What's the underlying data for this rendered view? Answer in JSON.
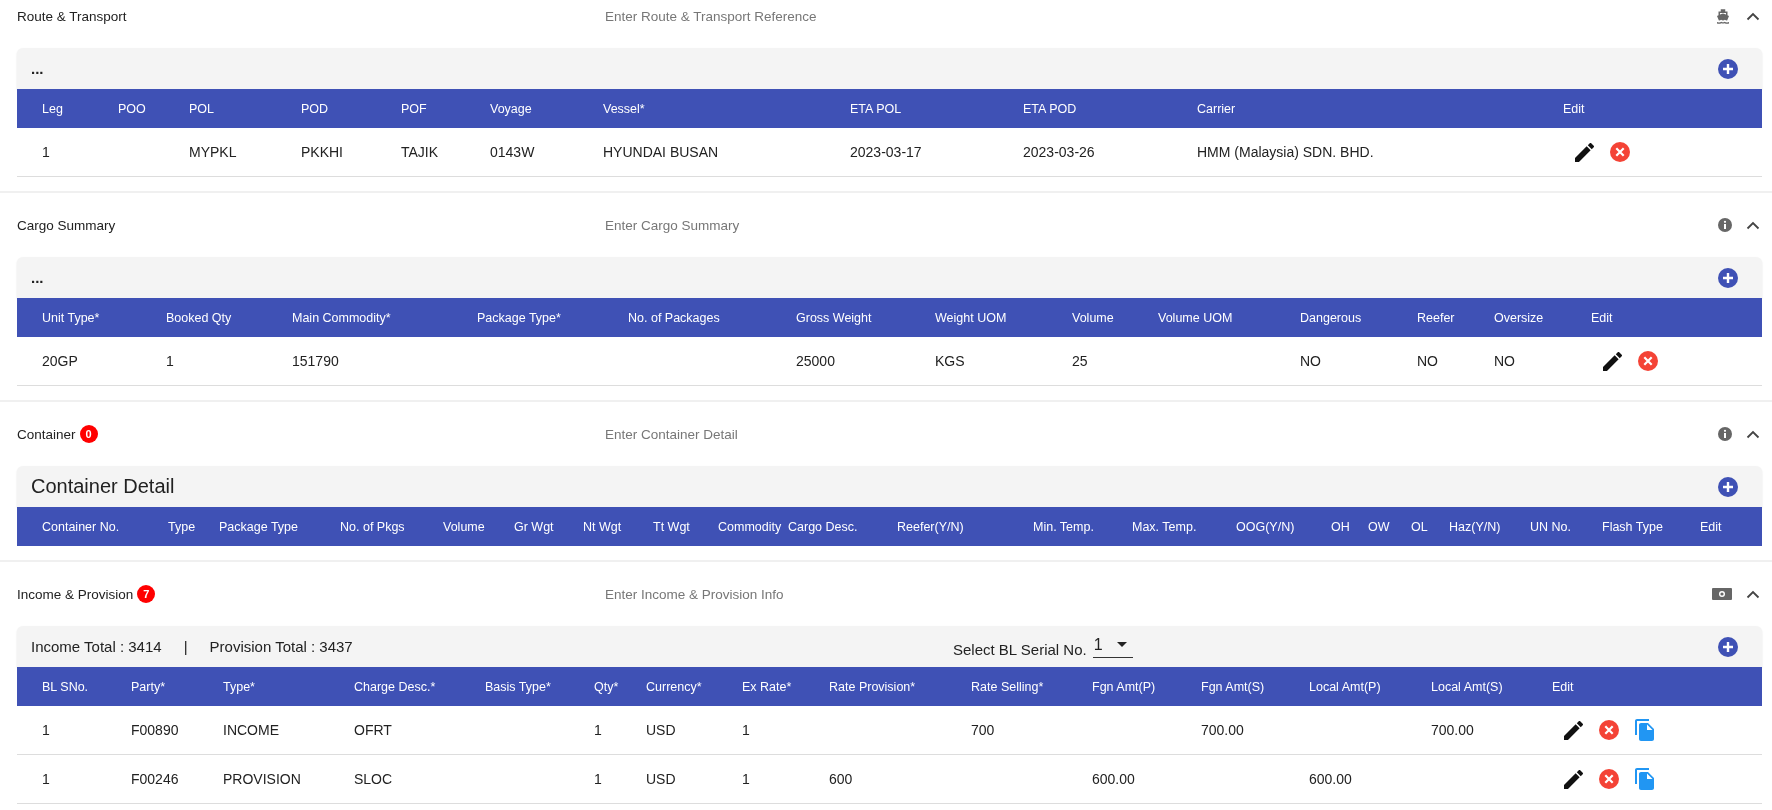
{
  "sections": [
    {
      "kind": "route",
      "title": "Route & Transport",
      "placeholder": "Enter Route & Transport Reference",
      "expanded": true,
      "toolbar": {
        "text": "..."
      },
      "columns": [
        "Leg",
        "POO",
        "POL",
        "POD",
        "POF",
        "Voyage",
        "Vessel*",
        "ETA POL",
        "ETA POD",
        "Carrier",
        "Edit"
      ],
      "rows": [
        {
          "cells": [
            "1",
            "",
            "MYPKL",
            "PKKHI",
            "TAJIK",
            "0143W",
            "HYUNDAI BUSAN",
            "2023-03-17",
            "2023-03-26",
            "HMM (Malaysia) SDN. BHD."
          ],
          "actions": [
            {
              "kind": "edit"
            },
            {
              "kind": "delete"
            }
          ]
        }
      ]
    },
    {
      "kind": "cargo",
      "title": "Cargo Summary",
      "placeholder": "Enter Cargo Summary",
      "expanded": true,
      "toolbar": {
        "text": "..."
      },
      "columns": [
        "Unit Type*",
        "Booked Qty",
        "Main Commodity*",
        "Package Type*",
        "No. of Packages",
        "Gross Weight",
        "Weight UOM",
        "Volume",
        "Volume UOM",
        "Dangerous",
        "Reefer",
        "Oversize",
        "Edit"
      ],
      "rows": [
        {
          "cells": [
            "20GP",
            "1",
            "151790",
            "",
            "",
            "25000",
            "KGS",
            "25",
            "",
            "NO",
            "NO",
            "NO"
          ],
          "actions": [
            {
              "kind": "edit"
            },
            {
              "kind": "delete"
            }
          ]
        }
      ]
    },
    {
      "kind": "container",
      "title": "Container",
      "badge": "0",
      "placeholder": "Enter Container Detail",
      "expanded": true,
      "toolbar": {
        "heading": "Container Detail"
      },
      "columns": [
        "Container No.",
        "Type",
        "Package Type",
        "No. of Pkgs",
        "Volume",
        "Gr Wgt",
        "Nt Wgt",
        "Tt Wgt",
        "Commodity",
        "Cargo Desc.",
        "Reefer(Y/N)",
        "Min. Temp.",
        "Max. Temp.",
        "OOG(Y/N)",
        "OH",
        "OW",
        "OL",
        "Haz(Y/N)",
        "UN No.",
        "Flash Type",
        "Edit"
      ]
    },
    {
      "kind": "income",
      "title": "Income & Provision",
      "badge": "7",
      "placeholder": "Enter Income & Provision Info",
      "expanded": true,
      "toolbar": {
        "totals": [
          "Income Total : 3414",
          "|",
          "Provision Total : 3437"
        ],
        "select_label": "Select BL Serial No.",
        "select_value": "1"
      },
      "columns": [
        "BL SNo.",
        "Party*",
        "Type*",
        "Charge Desc.*",
        "Basis Type*",
        "Qty*",
        "Currency*",
        "Ex Rate*",
        "Rate Provision*",
        "Rate Selling*",
        "Fgn Amt(P)",
        "Fgn Amt(S)",
        "Local Amt(P)",
        "Local Amt(S)",
        "Edit"
      ],
      "rows": [
        {
          "cells": [
            "1",
            "F00890",
            "INCOME",
            "OFRT",
            "",
            "1",
            "USD",
            "1",
            "",
            "700",
            "",
            "700.00",
            "",
            "700.00"
          ],
          "actions": [
            {
              "kind": "edit"
            },
            {
              "kind": "delete"
            },
            {
              "kind": "copy"
            }
          ]
        },
        {
          "cells": [
            "1",
            "F00246",
            "PROVISION",
            "SLOC",
            "",
            "1",
            "USD",
            "1",
            "600",
            "",
            "600.00",
            "",
            "600.00",
            ""
          ],
          "actions": [
            {
              "kind": "edit"
            },
            {
              "kind": "delete"
            },
            {
              "kind": "copy"
            }
          ]
        }
      ]
    }
  ]
}
